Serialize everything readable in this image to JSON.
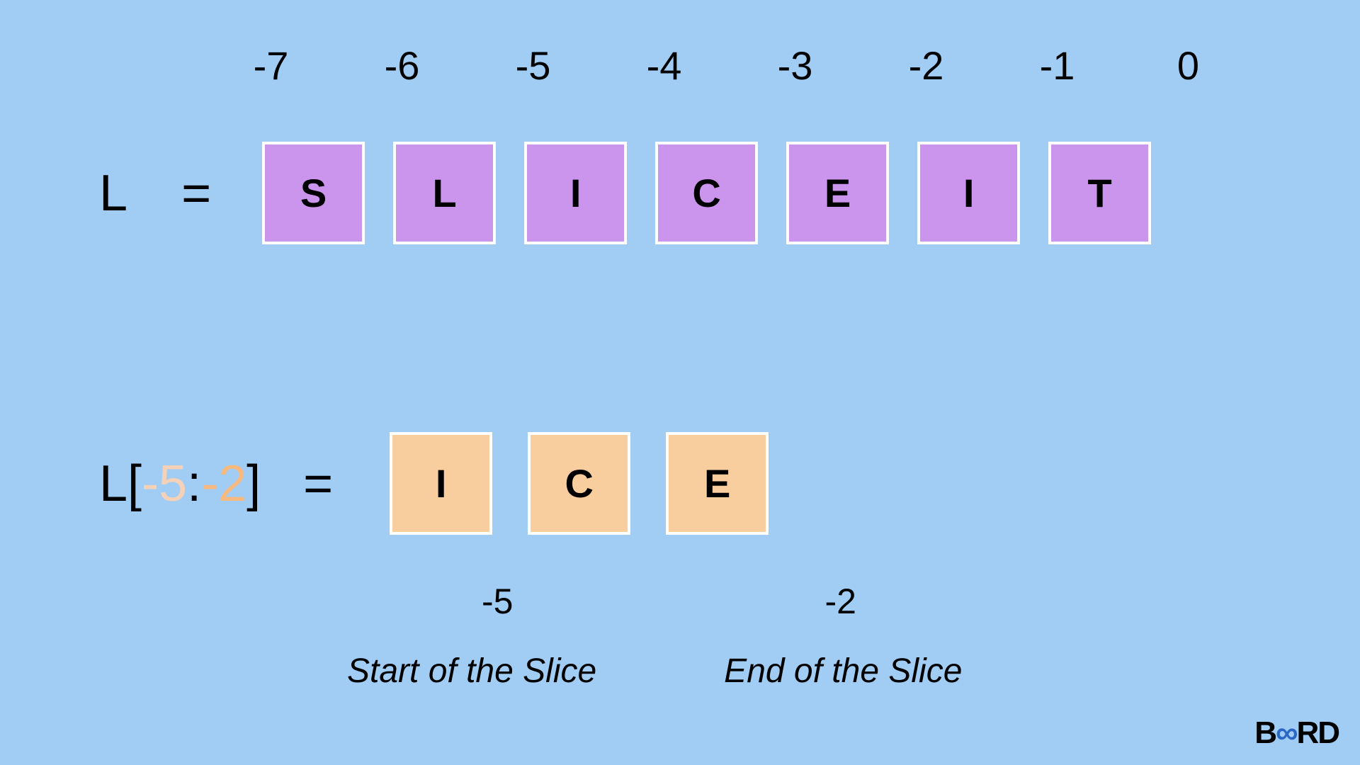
{
  "indices": [
    "-7",
    "-6",
    "-5",
    "-4",
    "-3",
    "-2",
    "-1",
    "0"
  ],
  "listVar": "L",
  "equals": "=",
  "letters": [
    "S",
    "L",
    "I",
    "C",
    "E",
    "I",
    "T"
  ],
  "slice": {
    "prefix": "L[",
    "a": "-5",
    "colon": ":",
    "b": "-2",
    "suffix": "]",
    "eq": "="
  },
  "sliceLetters": [
    "I",
    "C",
    "E"
  ],
  "subStart": "-5",
  "subEnd": "-2",
  "captions": {
    "start": "Start of the Slice",
    "end": "End of the Slice"
  },
  "logo": {
    "b": "B",
    "inf": "∞",
    "rd": "RD"
  },
  "chart_data": {
    "type": "table",
    "title": "Python negative-index slicing illustration",
    "list_name": "L",
    "list_values": [
      "S",
      "L",
      "I",
      "C",
      "E",
      "I",
      "T"
    ],
    "negative_indices": [
      -7,
      -6,
      -5,
      -4,
      -3,
      -2,
      -1,
      0
    ],
    "slice_expression": "L[-5:-2]",
    "slice_start": -5,
    "slice_end": -2,
    "slice_result": [
      "I",
      "C",
      "E"
    ],
    "annotations": {
      "start_label": "Start of the Slice",
      "end_label": "End of the Slice"
    }
  }
}
